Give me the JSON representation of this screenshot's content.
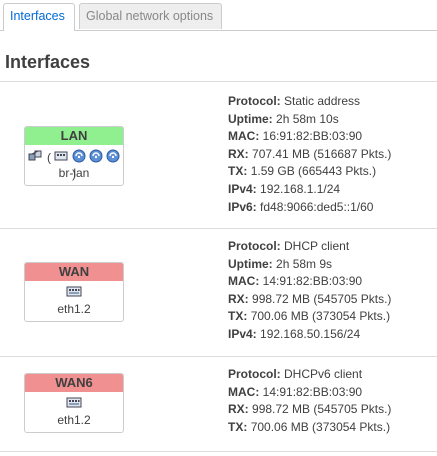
{
  "tabs": [
    {
      "label": "Interfaces",
      "active": true
    },
    {
      "label": "Global network options",
      "active": false
    }
  ],
  "page_title": "Interfaces",
  "interfaces": [
    {
      "name": "LAN",
      "status_color": "#90f090",
      "device": "br-lan",
      "icons": [
        "bridge-icon",
        "wireless-icon",
        "wireless-icon",
        "wireless-icon"
      ],
      "rows": [
        {
          "key": "Protocol:",
          "value": "Static address"
        },
        {
          "key": "Uptime:",
          "value": "2h 58m 10s"
        },
        {
          "key": "MAC:",
          "value": "16:91:82:BB:03:90"
        },
        {
          "key": "RX:",
          "value": "707.41 MB (516687 Pkts.)"
        },
        {
          "key": "TX:",
          "value": "1.59 GB (665443 Pkts.)"
        },
        {
          "key": "IPv4:",
          "value": "192.168.1.1/24"
        },
        {
          "key": "IPv6:",
          "value": "fd48:9066:ded5::1/60"
        }
      ]
    },
    {
      "name": "WAN",
      "status_color": "#f09090",
      "device": "eth1.2",
      "icons": [
        "ethernet-port-icon"
      ],
      "rows": [
        {
          "key": "Protocol:",
          "value": "DHCP client"
        },
        {
          "key": "Uptime:",
          "value": "2h 58m 9s"
        },
        {
          "key": "MAC:",
          "value": "14:91:82:BB:03:90"
        },
        {
          "key": "RX:",
          "value": "998.72 MB (545705 Pkts.)"
        },
        {
          "key": "TX:",
          "value": "700.06 MB (373054 Pkts.)"
        },
        {
          "key": "IPv4:",
          "value": "192.168.50.156/24"
        }
      ]
    },
    {
      "name": "WAN6",
      "status_color": "#f09090",
      "device": "eth1.2",
      "icons": [
        "ethernet-port-icon"
      ],
      "rows": [
        {
          "key": "Protocol:",
          "value": "DHCPv6 client"
        },
        {
          "key": "MAC:",
          "value": "14:91:82:BB:03:90"
        },
        {
          "key": "RX:",
          "value": "998.72 MB (545705 Pkts.)"
        },
        {
          "key": "TX:",
          "value": "700.06 MB (373054 Pkts.)"
        }
      ]
    }
  ]
}
